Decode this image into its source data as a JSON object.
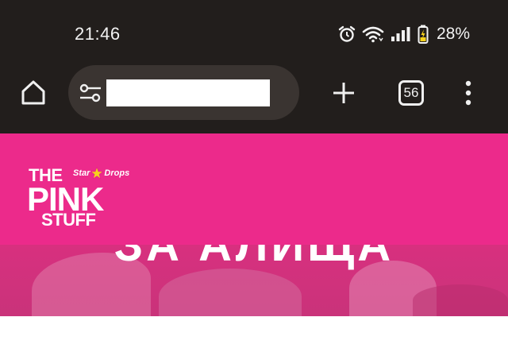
{
  "status_bar": {
    "time": "21:46",
    "battery_percent": "28%",
    "icons": [
      "alarm-icon",
      "wifi-icon",
      "signal-icon",
      "battery-charging-icon"
    ]
  },
  "browser": {
    "url_value": "",
    "tab_count": "56",
    "icons": [
      "home-icon",
      "tune-icon",
      "plus-icon",
      "tab-switcher-icon",
      "overflow-menu-icon"
    ]
  },
  "page": {
    "logo": {
      "line1": "THE",
      "line2": "PINK",
      "line3": "STUFF",
      "brand_left": "Star",
      "brand_right": "Drops"
    },
    "hero_heading": "ЗА АЛИЩА"
  },
  "colors": {
    "browser_chrome": "#221e1c",
    "omnibox": "#3a3431",
    "brand_pink": "#ec2a8b",
    "star_yellow": "#f7d21c"
  }
}
